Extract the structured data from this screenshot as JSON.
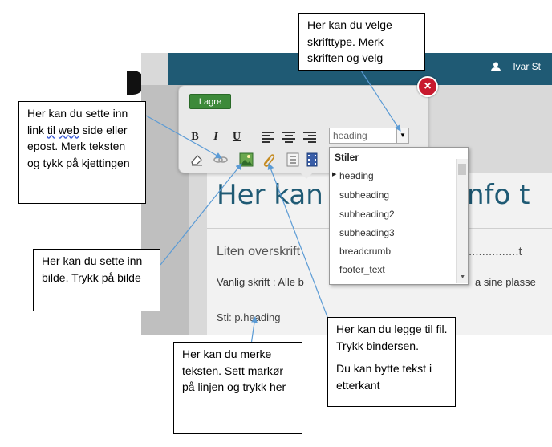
{
  "app": {
    "user_name": "Ivar St",
    "save_label": "Lagre",
    "close_glyph": "×",
    "toolbar": {
      "bold_label": "B",
      "italic_label": "I",
      "underline_label": "U",
      "style_select_value": "heading",
      "icons": [
        "eraser-icon",
        "link-icon",
        "image-icon",
        "paperclip-icon",
        "template-icon",
        "video-icon"
      ]
    },
    "styles_dropdown": {
      "title": "Stiler",
      "items": [
        "heading",
        "subheading",
        "subheading2",
        "subheading3",
        "breadcrumb",
        "footer_text"
      ],
      "selected": "heading"
    },
    "content": {
      "big_heading_left": "Her kan",
      "big_heading_right": "nfo t",
      "small_heading": "Liten overskrift",
      "dots": "...............t",
      "plain_text_left": "Vanlig skrift :  Alle b",
      "plain_text_right": "a sine plasse",
      "path_label": "Sti: p.heading"
    },
    "colors": {
      "topbar": "#1f5a74",
      "heading": "#1f5a74",
      "save_button": "#3d8a3a",
      "close_button": "#c8192e",
      "arrow": "#5b9bd5"
    }
  },
  "callouts": {
    "font_select": "Her kan du velge skrifttype. Merk skriften og velg",
    "link_prefix": "Her kan du sette inn link ",
    "link_til": "til",
    "link_mid": "  ",
    "link_web": "web",
    "link_suffix": " side eller epost. Merk teksten og tykk på kjettingen",
    "image": "Her kan du sette inn bilde. Trykk på bilde",
    "file_p1": "Her kan du legge til fil. Trykk bindersen.",
    "file_p2": "Du kan bytte tekst i etterkant",
    "mark": "Her kan du merke teksten. Sett markør på linjen og trykk her"
  }
}
